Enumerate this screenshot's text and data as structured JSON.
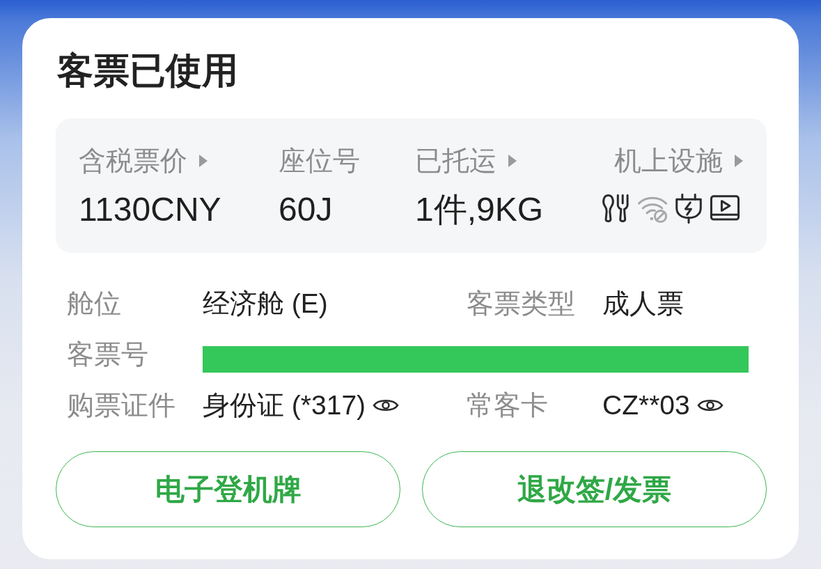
{
  "title": "客票已使用",
  "summary": [
    {
      "kind": "text",
      "label": "含税票价",
      "has_arrow": true,
      "value": "1130CNY"
    },
    {
      "kind": "text",
      "label": "座位号",
      "has_arrow": false,
      "value": "60J"
    },
    {
      "kind": "text",
      "label": "已托运",
      "has_arrow": true,
      "value": "1件,9KG"
    },
    {
      "kind": "facilities",
      "label": "机上设施",
      "has_arrow": true,
      "facilities": [
        {
          "kind": "meal",
          "available": true
        },
        {
          "kind": "wifi",
          "available": false
        },
        {
          "kind": "power",
          "available": true
        },
        {
          "kind": "video",
          "available": true
        }
      ]
    }
  ],
  "details": [
    {
      "fields": [
        {
          "label": "舱位",
          "value": "经济舱 (E)",
          "reveal_toggle": false
        },
        {
          "label": "客票类型",
          "value": "成人票",
          "reveal_toggle": false
        }
      ]
    },
    {
      "fields": [
        {
          "label": "客票号",
          "redacted": true
        }
      ]
    },
    {
      "fields": [
        {
          "label": "购票证件",
          "value": "身份证 (*317)",
          "reveal_toggle": true
        },
        {
          "label": "常客卡",
          "value": "CZ**03",
          "reveal_toggle": true
        }
      ]
    }
  ],
  "buttons": [
    {
      "label": "电子登机牌"
    },
    {
      "label": "退改签/发票"
    }
  ]
}
